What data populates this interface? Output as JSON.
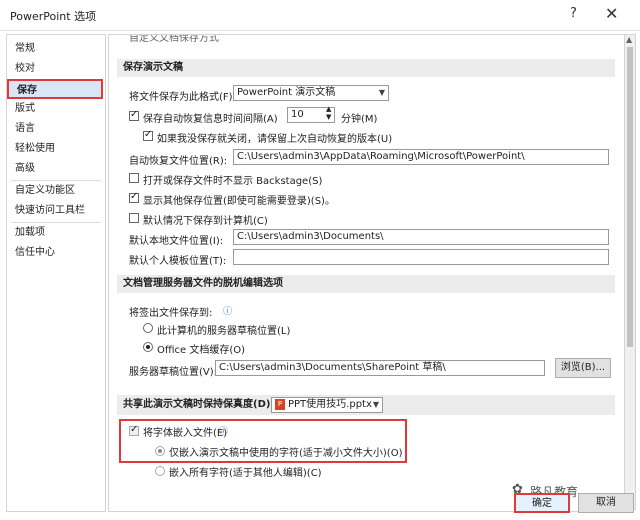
{
  "window": {
    "title": "PowerPoint 选项",
    "help": "?",
    "close": "✕"
  },
  "sidebar": {
    "items": [
      {
        "label": "常规"
      },
      {
        "label": "校对"
      },
      {
        "label": "保存"
      },
      {
        "label": "版式"
      },
      {
        "label": "语言"
      },
      {
        "label": "轻松使用"
      },
      {
        "label": "高级"
      },
      {
        "label": "自定义功能区"
      },
      {
        "label": "快速访问工具栏"
      },
      {
        "label": "加载项"
      },
      {
        "label": "信任中心"
      }
    ]
  },
  "top_partial": {
    "text": "自定义文档保存方式"
  },
  "save": {
    "header": "保存演示文稿",
    "format_label": "将文件保存为此格式(F):",
    "format_value": "PowerPoint 演示文稿",
    "autorecover_label": "保存自动恢复信息时间间隔(A)",
    "autorecover_value": "10",
    "minutes_label": "分钟(M)",
    "keep_last_label": "如果我没保存就关闭，请保留上次自动恢复的版本(U)",
    "autorecover_loc_label": "自动恢复文件位置(R):",
    "autorecover_loc_value": "C:\\Users\\admin3\\AppData\\Roaming\\Microsoft\\PowerPoint\\",
    "no_backstage_label": "打开或保存文件时不显示 Backstage(S)",
    "show_other_label": "显示其他保存位置(即使可能需要登录)(S)。",
    "default_computer_label": "默认情况下保存到计算机(C)",
    "default_local_label": "默认本地文件位置(I):",
    "default_local_value": "C:\\Users\\admin3\\Documents\\",
    "default_template_label": "默认个人模板位置(T):",
    "default_template_value": ""
  },
  "offline": {
    "header": "文档管理服务器文件的脱机编辑选项",
    "checkout_label": "将签出文件保存到:",
    "opt_server": "此计算机的服务器草稿位置(L)",
    "opt_office": "Office 文档缓存(O)",
    "drafts_label": "服务器草稿位置(V):",
    "drafts_value": "C:\\Users\\admin3\\Documents\\SharePoint 草稿\\",
    "browse_label": "浏览(B)..."
  },
  "fidelity": {
    "header": "共享此演示文稿时保持保真度(D):",
    "file_value": "PPT使用技巧.pptx",
    "embed_label": "将字体嵌入文件(E)",
    "embed_used_label": "仅嵌入演示文稿中使用的字符(适于减小文件大小)(O)",
    "embed_all_label": "嵌入所有字符(适于其他人编辑)(C)"
  },
  "buttons": {
    "ok": "确定",
    "cancel": "取消"
  },
  "watermark": {
    "text": "路凡教育"
  },
  "icons": {
    "info": "info-icon",
    "ppt": "ppt-file-icon",
    "dropdown": "chevron-down-icon"
  },
  "colors": {
    "highlight": "#e0393b",
    "selected_bg": "#d9e6f5",
    "section_bg": "#ececec"
  }
}
